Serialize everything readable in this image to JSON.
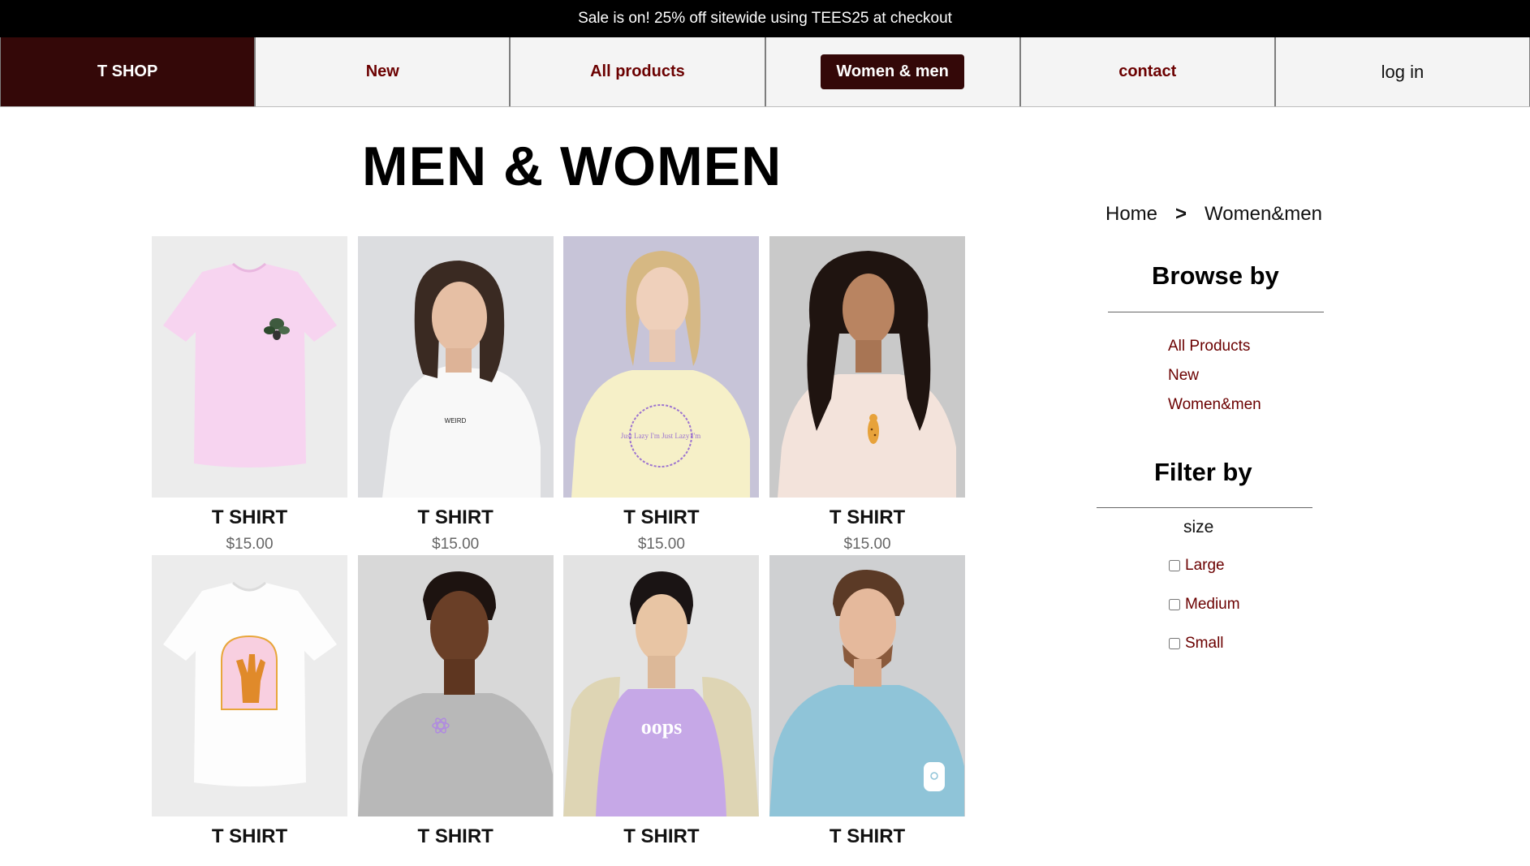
{
  "promo": {
    "text": "Sale is on! 25% off sitewide using TEES25 at checkout"
  },
  "nav": {
    "brand": "T SHOP",
    "new": "New",
    "all_products": "All products",
    "women_men": "Women & men",
    "contact": "contact",
    "login": "log in"
  },
  "page": {
    "title": "MEN & WOMEN"
  },
  "products": [
    {
      "name": "T SHIRT",
      "price": "$15.00"
    },
    {
      "name": "T SHIRT",
      "price": "$15.00"
    },
    {
      "name": "T SHIRT",
      "price": "$15.00"
    },
    {
      "name": "T SHIRT",
      "price": "$15.00"
    },
    {
      "name": "T SHIRT",
      "price": ""
    },
    {
      "name": "T SHIRT",
      "price": ""
    },
    {
      "name": "T SHIRT",
      "price": ""
    },
    {
      "name": "T SHIRT",
      "price": ""
    }
  ],
  "product_prints": {
    "p2": "WEIRD",
    "p3": "Just Lazy I'm Just Lazy I'm",
    "p7": "oops"
  },
  "breadcrumb": {
    "home": "Home",
    "sep": ">",
    "current": "Women&men"
  },
  "browse": {
    "title": "Browse by",
    "links": [
      "All Products",
      "New",
      "Women&men"
    ]
  },
  "filter": {
    "title": "Filter by",
    "size_label": "size",
    "options": [
      "Large",
      "Medium",
      "Small"
    ]
  },
  "colors": {
    "brand_dark": "#340808",
    "accent_text": "#6b0000",
    "promo_bg": "#000000"
  }
}
